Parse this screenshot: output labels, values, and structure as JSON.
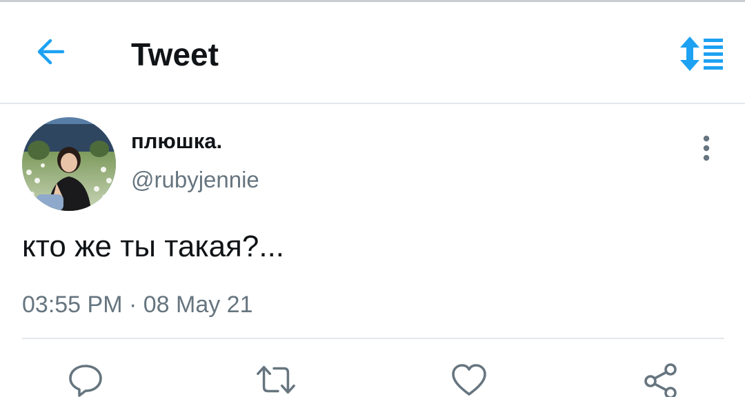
{
  "header": {
    "title": "Tweet",
    "back_icon": "arrow-left-icon",
    "sort_icon": "sort-toggle-icon",
    "accent_color": "#1da1f2"
  },
  "tweet": {
    "author": {
      "display_name": "плюшка.",
      "handle": "@rubyjennie",
      "avatar": "profile-photo"
    },
    "text": "кто же ты такая?...",
    "timestamp": "03:55 PM · 08 May 21",
    "actions": [
      {
        "name": "reply",
        "icon": "comment-icon"
      },
      {
        "name": "retweet",
        "icon": "retweet-icon"
      },
      {
        "name": "like",
        "icon": "heart-icon"
      },
      {
        "name": "share",
        "icon": "share-icon"
      }
    ]
  },
  "colors": {
    "text_primary": "#111417",
    "text_secondary": "#66757f",
    "divider": "#e4e8ec",
    "icon_gray": "#66757f"
  }
}
